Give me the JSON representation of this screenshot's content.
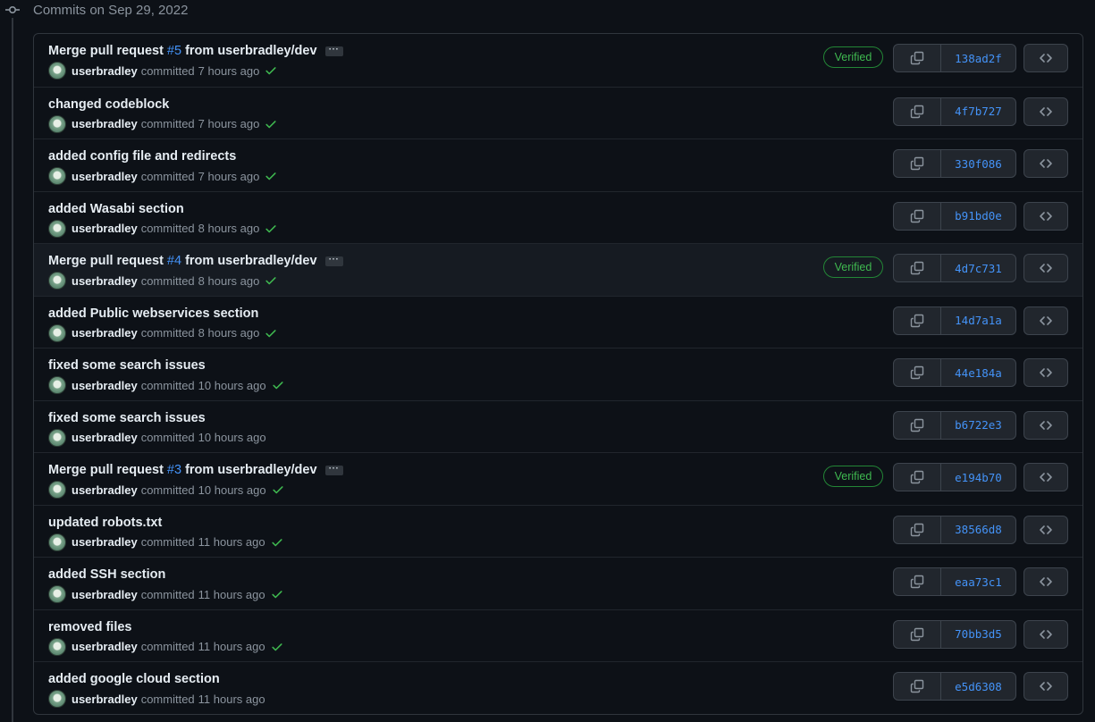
{
  "group": {
    "title": "Commits on Sep 29, 2022"
  },
  "labels": {
    "verified": "Verified",
    "committed": "committed",
    "ellipsis": "···"
  },
  "colors": {
    "background": "#0d1117",
    "border": "#30363d",
    "link": "#4493f8",
    "success": "#3fb950",
    "muted": "#8b949e"
  },
  "icons": {
    "commit": "git-commit-icon",
    "copy": "copy-icon",
    "browse": "code-icon",
    "check": "check-icon"
  },
  "commits": [
    {
      "title_pre": "Merge pull request",
      "pr": "#5",
      "title_post": "from userbradley/dev",
      "is_merge": true,
      "verified": true,
      "highlight": false,
      "author": "userbradley",
      "time": "7 hours ago",
      "checks": true,
      "sha": "138ad2f"
    },
    {
      "title_pre": "changed codeblock",
      "pr": "",
      "title_post": "",
      "is_merge": false,
      "verified": false,
      "highlight": false,
      "author": "userbradley",
      "time": "7 hours ago",
      "checks": true,
      "sha": "4f7b727"
    },
    {
      "title_pre": "added config file and redirects",
      "pr": "",
      "title_post": "",
      "is_merge": false,
      "verified": false,
      "highlight": false,
      "author": "userbradley",
      "time": "7 hours ago",
      "checks": true,
      "sha": "330f086"
    },
    {
      "title_pre": "added Wasabi section",
      "pr": "",
      "title_post": "",
      "is_merge": false,
      "verified": false,
      "highlight": false,
      "author": "userbradley",
      "time": "8 hours ago",
      "checks": true,
      "sha": "b91bd0e"
    },
    {
      "title_pre": "Merge pull request",
      "pr": "#4",
      "title_post": "from userbradley/dev",
      "is_merge": true,
      "verified": true,
      "highlight": true,
      "author": "userbradley",
      "time": "8 hours ago",
      "checks": true,
      "sha": "4d7c731"
    },
    {
      "title_pre": "added Public webservices section",
      "pr": "",
      "title_post": "",
      "is_merge": false,
      "verified": false,
      "highlight": false,
      "author": "userbradley",
      "time": "8 hours ago",
      "checks": true,
      "sha": "14d7a1a"
    },
    {
      "title_pre": "fixed some search issues",
      "pr": "",
      "title_post": "",
      "is_merge": false,
      "verified": false,
      "highlight": false,
      "author": "userbradley",
      "time": "10 hours ago",
      "checks": true,
      "sha": "44e184a"
    },
    {
      "title_pre": "fixed some search issues",
      "pr": "",
      "title_post": "",
      "is_merge": false,
      "verified": false,
      "highlight": false,
      "author": "userbradley",
      "time": "10 hours ago",
      "checks": false,
      "sha": "b6722e3"
    },
    {
      "title_pre": "Merge pull request",
      "pr": "#3",
      "title_post": "from userbradley/dev",
      "is_merge": true,
      "verified": true,
      "highlight": false,
      "author": "userbradley",
      "time": "10 hours ago",
      "checks": true,
      "sha": "e194b70"
    },
    {
      "title_pre": "updated robots.txt",
      "pr": "",
      "title_post": "",
      "is_merge": false,
      "verified": false,
      "highlight": false,
      "author": "userbradley",
      "time": "11 hours ago",
      "checks": true,
      "sha": "38566d8"
    },
    {
      "title_pre": "added SSH section",
      "pr": "",
      "title_post": "",
      "is_merge": false,
      "verified": false,
      "highlight": false,
      "author": "userbradley",
      "time": "11 hours ago",
      "checks": true,
      "sha": "eaa73c1"
    },
    {
      "title_pre": "removed files",
      "pr": "",
      "title_post": "",
      "is_merge": false,
      "verified": false,
      "highlight": false,
      "author": "userbradley",
      "time": "11 hours ago",
      "checks": true,
      "sha": "70bb3d5"
    },
    {
      "title_pre": "added google cloud section",
      "pr": "",
      "title_post": "",
      "is_merge": false,
      "verified": false,
      "highlight": false,
      "author": "userbradley",
      "time": "11 hours ago",
      "checks": false,
      "sha": "e5d6308"
    }
  ]
}
